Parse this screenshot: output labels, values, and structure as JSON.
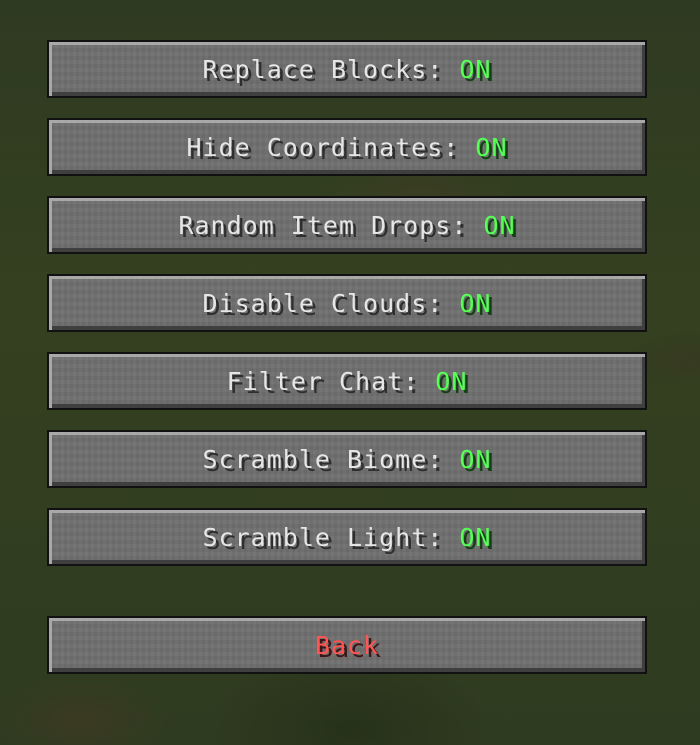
{
  "options": [
    {
      "label": "Replace Blocks: ",
      "value": "ON"
    },
    {
      "label": "Hide Coordinates: ",
      "value": "ON"
    },
    {
      "label": "Random Item Drops: ",
      "value": "ON"
    },
    {
      "label": "Disable Clouds: ",
      "value": "ON"
    },
    {
      "label": "Filter Chat: ",
      "value": "ON"
    },
    {
      "label": "Scramble Biome: ",
      "value": "ON"
    },
    {
      "label": "Scramble Light: ",
      "value": "ON"
    }
  ],
  "back": {
    "label": "Back"
  },
  "colors": {
    "on_value": "#55ff55",
    "back_text": "#ff5555",
    "button_face": "#6f6f6f",
    "label_text": "#e6e6e6"
  }
}
